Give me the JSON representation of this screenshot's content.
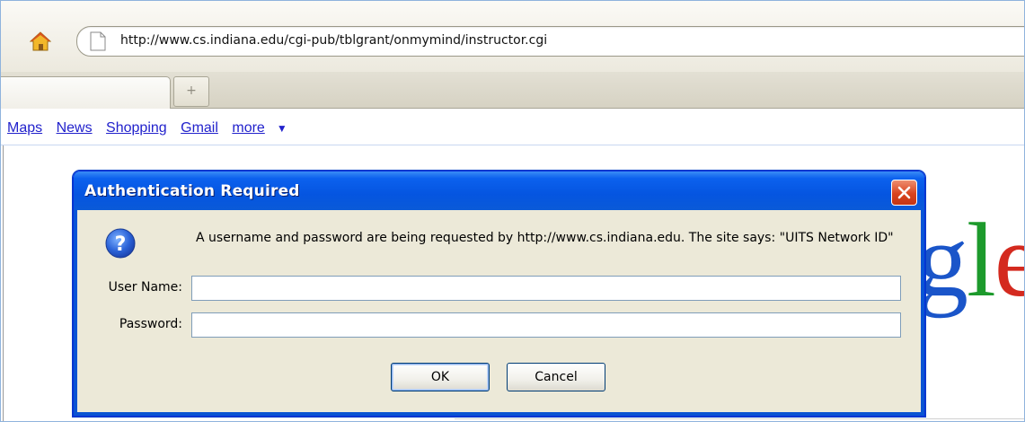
{
  "browser": {
    "url": "http://www.cs.indiana.edu/cgi-pub/tblgrant/onmymind/instructor.cgi",
    "new_tab_symbol": "+",
    "icons": [
      "home-icon",
      "page-icon"
    ]
  },
  "google_bar": {
    "links": [
      "Maps",
      "News",
      "Shopping",
      "Gmail"
    ],
    "more_label": "more",
    "more_arrow": "▼"
  },
  "google_logo_fragment": {
    "g": "g",
    "l": "l",
    "e": "e",
    "colors": {
      "g": "#1a55c9",
      "l": "#1d9a2c",
      "e": "#d42a1f"
    }
  },
  "dialog": {
    "title": "Authentication Required",
    "message": "A username and password are being requested by http://www.cs.indiana.edu. The site says: \"UITS Network ID\"",
    "username_label": "User Name:",
    "username_value": "",
    "password_label": "Password:",
    "password_value": "",
    "ok_label": "OK",
    "cancel_label": "Cancel",
    "icons": [
      "question-icon",
      "close-icon"
    ],
    "colors": {
      "titlebar": "#0555e0",
      "client": "#ece9d8",
      "close": "#d9431e"
    }
  }
}
